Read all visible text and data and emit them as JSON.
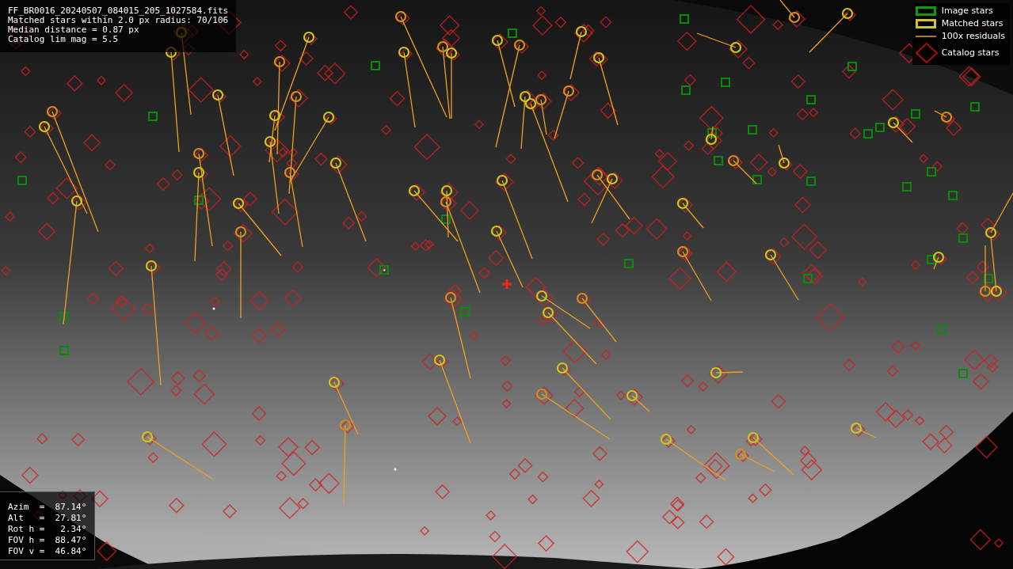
{
  "info": {
    "lines": [
      "FF_BR0016_20240507_084015_205_1027584.fits",
      "Matched stars within 2.0 px radius: 70/106",
      "Median distance = 0.87 px",
      "Catalog lim mag = 5.5"
    ]
  },
  "legend": [
    {
      "label": "Image stars"
    },
    {
      "kind": "matched",
      "label": "Matched stars"
    },
    {
      "kind": "residual",
      "label": "100x residuals"
    },
    {
      "kind": "catalog",
      "label": "Catalog stars"
    }
  ],
  "pointing": [
    "Azim  =  87.14°",
    "Alt   =  27.81°",
    "Rot h =   2.34°",
    "FOV h =  88.47°",
    "FOV v =  46.84°"
  ]
}
